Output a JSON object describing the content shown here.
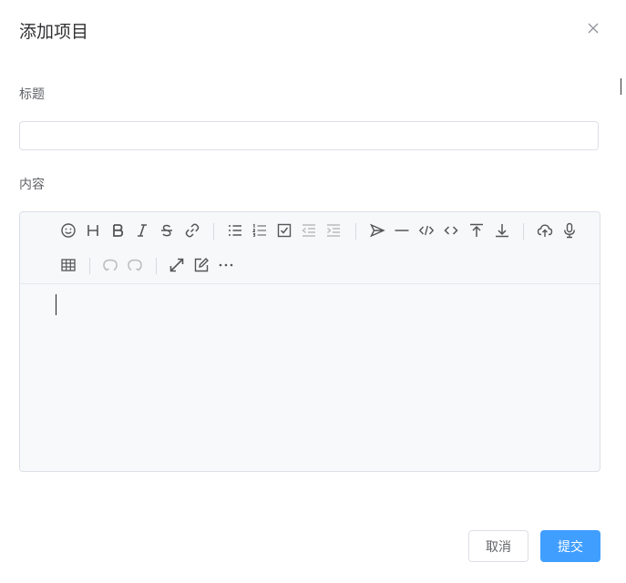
{
  "dialog": {
    "title": "添加项目",
    "close_icon": "close-icon"
  },
  "form": {
    "title_label": "标题",
    "title_value": "",
    "title_placeholder": "",
    "content_label": "内容"
  },
  "editor": {
    "toolbar_row1": [
      "emoji",
      "headings",
      "bold",
      "italic",
      "strike",
      "link",
      "list",
      "ordered-list",
      "check",
      "outdent",
      "indent",
      "quote",
      "line",
      "code",
      "inline-code",
      "insert-before",
      "insert-after",
      "upload",
      "record"
    ],
    "toolbar_row2": [
      "table",
      "undo",
      "redo",
      "fullscreen",
      "edit-mode",
      "more"
    ],
    "content": ""
  },
  "footer": {
    "cancel_label": "取消",
    "submit_label": "提交"
  },
  "colors": {
    "primary": "#409eff",
    "border": "#dcdfe6",
    "text": "#606266",
    "title": "#303133"
  }
}
